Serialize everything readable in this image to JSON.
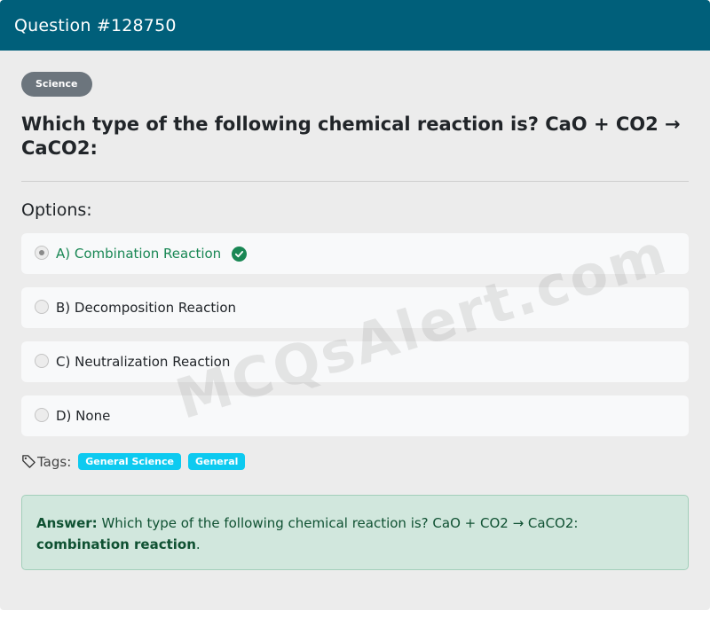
{
  "header": {
    "title": "Question #128750"
  },
  "category_badge": "Science",
  "question": {
    "text": "Which type of the following chemical reaction is? CaO + CO2 → CaCO2:"
  },
  "options_heading": "Options:",
  "options": [
    {
      "label": "A) Combination Reaction",
      "selected": true,
      "correct": true
    },
    {
      "label": "B) Decomposition Reaction",
      "selected": false,
      "correct": false
    },
    {
      "label": "C) Neutralization Reaction",
      "selected": false,
      "correct": false
    },
    {
      "label": "D) None",
      "selected": false,
      "correct": false
    }
  ],
  "tags": {
    "label": "Tags:",
    "items": [
      "General Science",
      "General"
    ]
  },
  "answer": {
    "key": "Answer:",
    "text": "Which type of the following chemical reaction is? CaO + CO2 → CaCO2:",
    "bold_answer": "combination reaction",
    "suffix": "."
  },
  "watermark": "MCQsAlert.com",
  "colors": {
    "header": "#005f7a",
    "correct": "#198754",
    "tag": "#0dcaf0",
    "answer_bg": "#d1e7dd"
  },
  "icons": {
    "tag": "tag-icon",
    "check": "check-circle-icon"
  }
}
